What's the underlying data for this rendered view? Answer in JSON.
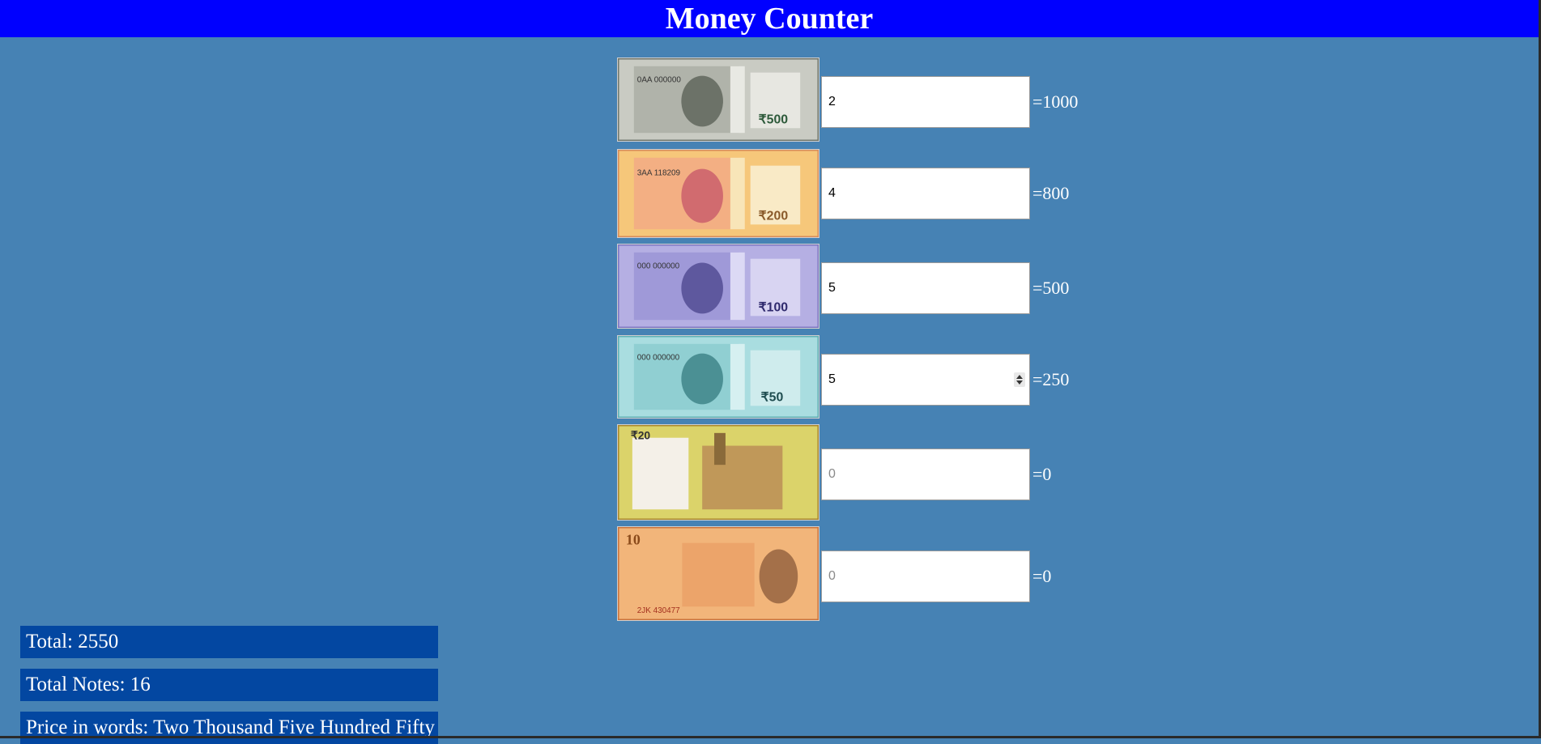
{
  "header": {
    "title": "Money Counter"
  },
  "notes": [
    {
      "denomination_text": "₹500",
      "serial": "0AA 000000",
      "count_value": "2",
      "placeholder": "0",
      "amount": "1000",
      "bg": "#c9cbc3",
      "accent": "#6f766c"
    },
    {
      "denomination_text": "₹200",
      "serial": "3AA 118209",
      "count_value": "4",
      "placeholder": "0",
      "amount": "800",
      "bg": "#f6c77a",
      "accent": "#d88c5a"
    },
    {
      "denomination_text": "₹100",
      "serial": "000 000000",
      "count_value": "5",
      "placeholder": "0",
      "amount": "500",
      "bg": "#b5afe3",
      "accent": "#7d76c2"
    },
    {
      "denomination_text": "₹50",
      "serial": "000 000000",
      "count_value": "5",
      "placeholder": "0",
      "amount": "250",
      "bg": "#a9dde0",
      "accent": "#5fb0b5"
    },
    {
      "denomination_text": "₹20",
      "serial": "",
      "count_value": "",
      "placeholder": "0",
      "amount": "0",
      "bg": "#dbd36a",
      "accent": "#a8862e"
    },
    {
      "denomination_text": "10",
      "serial": "2JK 430477",
      "count_value": "",
      "placeholder": "0",
      "amount": "0",
      "bg": "#f2b57a",
      "accent": "#c9733d"
    }
  ],
  "summary": {
    "total": "Total: 2550",
    "total_notes": "Total Notes: 16",
    "price_in_words": "Price in words: Two Thousand Five Hundred Fifty"
  },
  "colors": {
    "page_bg": "#4682b4",
    "header_bg": "#0000ff",
    "summary_bg": "#0347a1"
  }
}
